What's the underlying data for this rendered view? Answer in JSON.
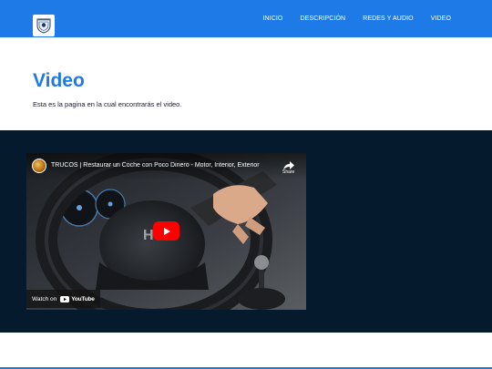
{
  "colors": {
    "brand": "#1e7ae6",
    "dark_section": "#061a2e",
    "youtube_red": "#ff0000"
  },
  "navbar": {
    "logo_icon": "crest-logo-icon",
    "links": [
      {
        "label": "INICIO"
      },
      {
        "label": "DESCRIPCIÓN"
      },
      {
        "label": "REDES Y AUDIO"
      },
      {
        "label": "VIDEO"
      }
    ]
  },
  "hero": {
    "title": "Video",
    "description": "Esta es la pagina en la cual encontrarás el video."
  },
  "video": {
    "title": "TRUCOS | Restaurar un Coche con Poco Dinero - Motor, Interior, Exterior",
    "share_label": "Share",
    "watch_on_label": "Watch on",
    "youtube_label": "YouTube",
    "icons": [
      "channel-avatar",
      "share-icon",
      "play-icon",
      "youtube-logo-icon"
    ]
  }
}
